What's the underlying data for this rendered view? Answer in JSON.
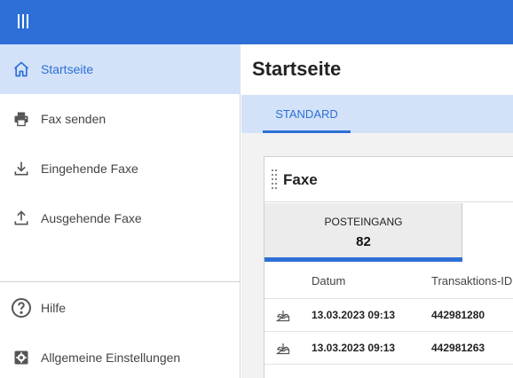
{
  "topbar": {
    "menu_icon": "hamburger-icon",
    "color": "#2d6fd6"
  },
  "sidebar": {
    "items": [
      {
        "label": "Startseite",
        "icon": "home-icon",
        "active": true
      },
      {
        "label": "Fax senden",
        "icon": "printer-icon"
      },
      {
        "label": "Eingehende Faxe",
        "icon": "download-icon"
      },
      {
        "label": "Ausgehende Faxe",
        "icon": "upload-icon"
      }
    ],
    "footer_items": [
      {
        "label": "Hilfe",
        "icon": "help-icon"
      },
      {
        "label": "Allgemeine Einstellungen",
        "icon": "settings-icon"
      }
    ]
  },
  "main": {
    "title": "Startseite",
    "tabs": [
      {
        "label": "STANDARD",
        "active": true
      }
    ],
    "card": {
      "title": "Faxe",
      "inbox": {
        "label": "POSTEINGANG",
        "count": "82"
      },
      "table": {
        "columns": [
          "Datum",
          "Transaktions-ID"
        ],
        "rows": [
          {
            "icon": "inbox-tray-icon",
            "date": "13.03.2023 09:13",
            "id": "442981280"
          },
          {
            "icon": "inbox-tray-icon",
            "date": "13.03.2023 09:13",
            "id": "442981263"
          }
        ]
      }
    }
  },
  "colors": {
    "accent": "#2d6fd6",
    "active_bg": "#d3e2f8",
    "tile_bg": "#ececec"
  }
}
